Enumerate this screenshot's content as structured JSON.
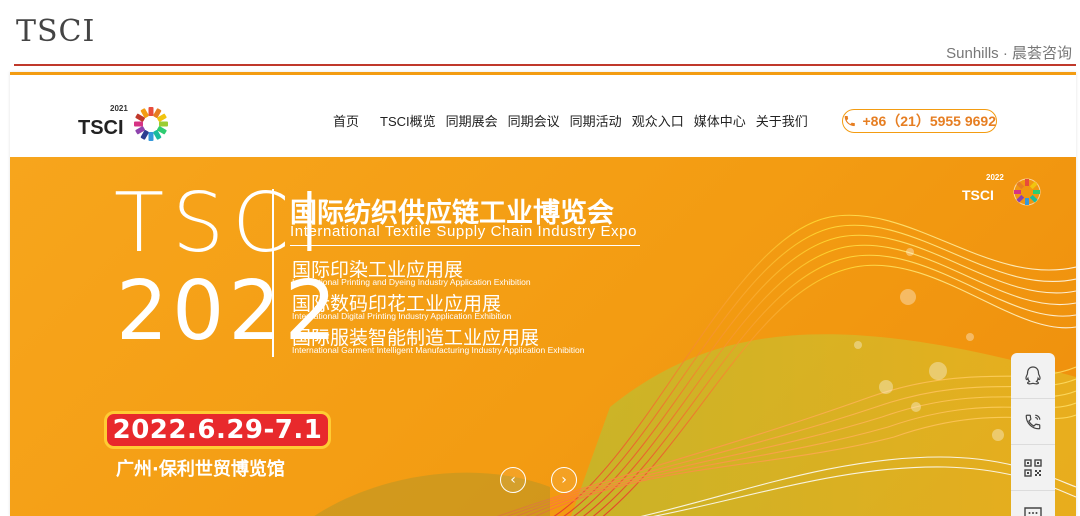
{
  "slide": {
    "title": "TSCI",
    "brand": "Sunhills · 晨荟咨询",
    "accent_red": "#c0392b"
  },
  "site": {
    "logo": {
      "text": "TSCI",
      "year": "2021"
    },
    "nav": {
      "items": [
        {
          "label": "首页"
        },
        {
          "label": "TSCI概览"
        },
        {
          "label": "同期展会"
        },
        {
          "label": "同期会议"
        },
        {
          "label": "同期活动"
        },
        {
          "label": "观众入口"
        },
        {
          "label": "媒体中心"
        },
        {
          "label": "关于我们"
        }
      ]
    },
    "phone": {
      "icon": "phone-icon",
      "text": "+86（21）5955 9692"
    },
    "colors": {
      "orange": "#f39c12",
      "red": "#e8292c",
      "yellow": "#ffcc33"
    }
  },
  "banner": {
    "acronym": "TSCI",
    "year": "2022",
    "title_cn": "国际纺织供应链工业博览会",
    "title_en": "International  Textile  Supply Chain  Industry  Expo",
    "sub_events": [
      {
        "cn": "国际印染工业应用展",
        "en": "International Printing and Dyeing Industry Application Exhibition"
      },
      {
        "cn": "国际数码印花工业应用展",
        "en": "International Digital Printing Industry Application Exhibition"
      },
      {
        "cn": "国际服装智能制造工业应用展",
        "en": "International Garment Intelligent Manufacturing Industry Application Exhibition"
      }
    ],
    "date": "2022.6.29-7.1",
    "venue": "广州·保利世贸博览馆",
    "mini_logo": {
      "text": "TSCI",
      "year": "2022"
    },
    "prev_icon": "chevron-left-icon",
    "next_icon": "chevron-right-icon"
  },
  "side_tools": [
    {
      "icon": "qq-icon"
    },
    {
      "icon": "phone-icon"
    },
    {
      "icon": "qrcode-icon"
    },
    {
      "icon": "chat-icon"
    }
  ]
}
